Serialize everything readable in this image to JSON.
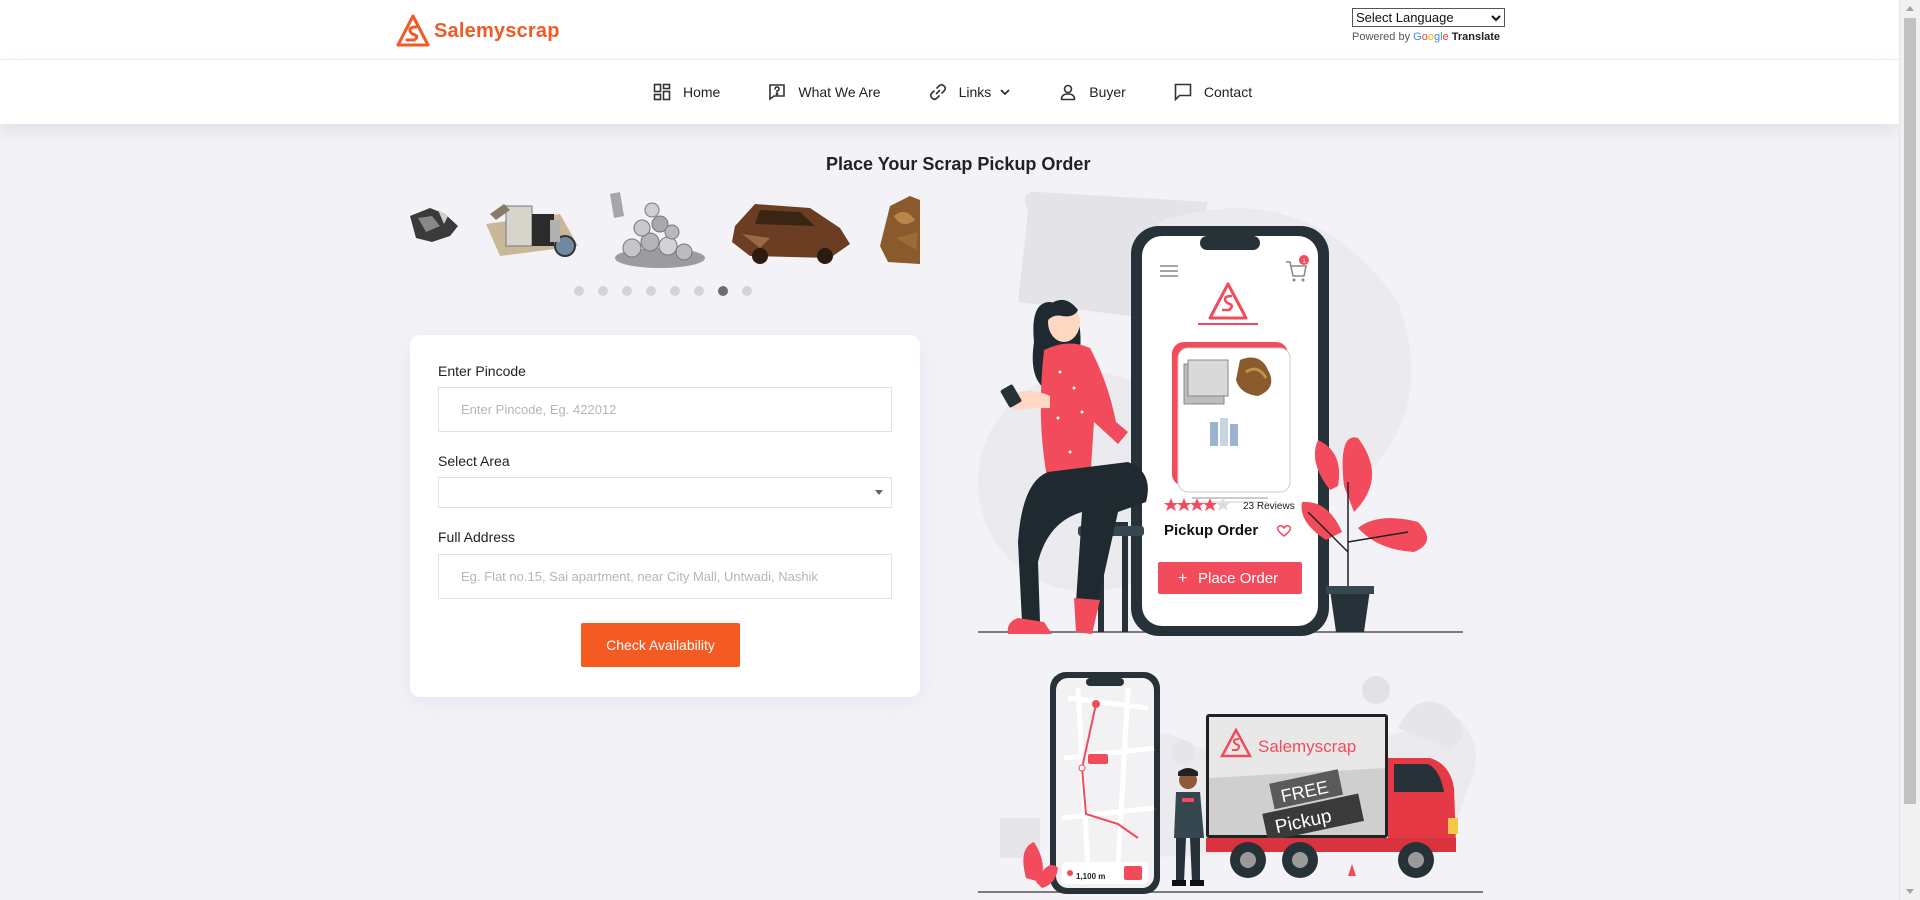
{
  "brand": {
    "name": "Salemyscrap",
    "color": "#f15a24"
  },
  "translate": {
    "select_label": "Select Language",
    "powered_by": "Powered by",
    "google": "Google",
    "translate": "Translate"
  },
  "nav": {
    "items": [
      {
        "label": "Home",
        "icon": "dashboard-grid-icon"
      },
      {
        "label": "What We Are",
        "icon": "help-message-icon"
      },
      {
        "label": "Links",
        "icon": "link-icon",
        "has_dropdown": true
      },
      {
        "label": "Buyer",
        "icon": "user-icon"
      },
      {
        "label": "Contact",
        "icon": "chat-icon"
      }
    ]
  },
  "main": {
    "heading": "Place Your Scrap Pickup Order",
    "carousel": {
      "slide_count": 8,
      "active_index": 6
    }
  },
  "form": {
    "pincode_label": "Enter Pincode",
    "pincode_placeholder": "Enter Pincode, Eg. 422012",
    "area_label": "Select Area",
    "area_value": "",
    "address_label": "Full Address",
    "address_placeholder": "Eg. Flat no.15, Sai apartment, near City Mall, Untwadi, Nashik",
    "submit_label": "Check Availability"
  },
  "illustration_phone": {
    "reviews": "23 Reviews",
    "rating": 4,
    "rating_max": 5,
    "title": "Pickup Order",
    "button": "Place Order",
    "cart_count": "1"
  },
  "illustration_truck": {
    "truck_brand": "Salemyscrap",
    "free": "FREE",
    "pickup": "Pickup",
    "distance": "1,100 m"
  },
  "colors": {
    "accent": "#f45a22",
    "illustration_red": "#f24c5c",
    "dark": "#222222"
  }
}
